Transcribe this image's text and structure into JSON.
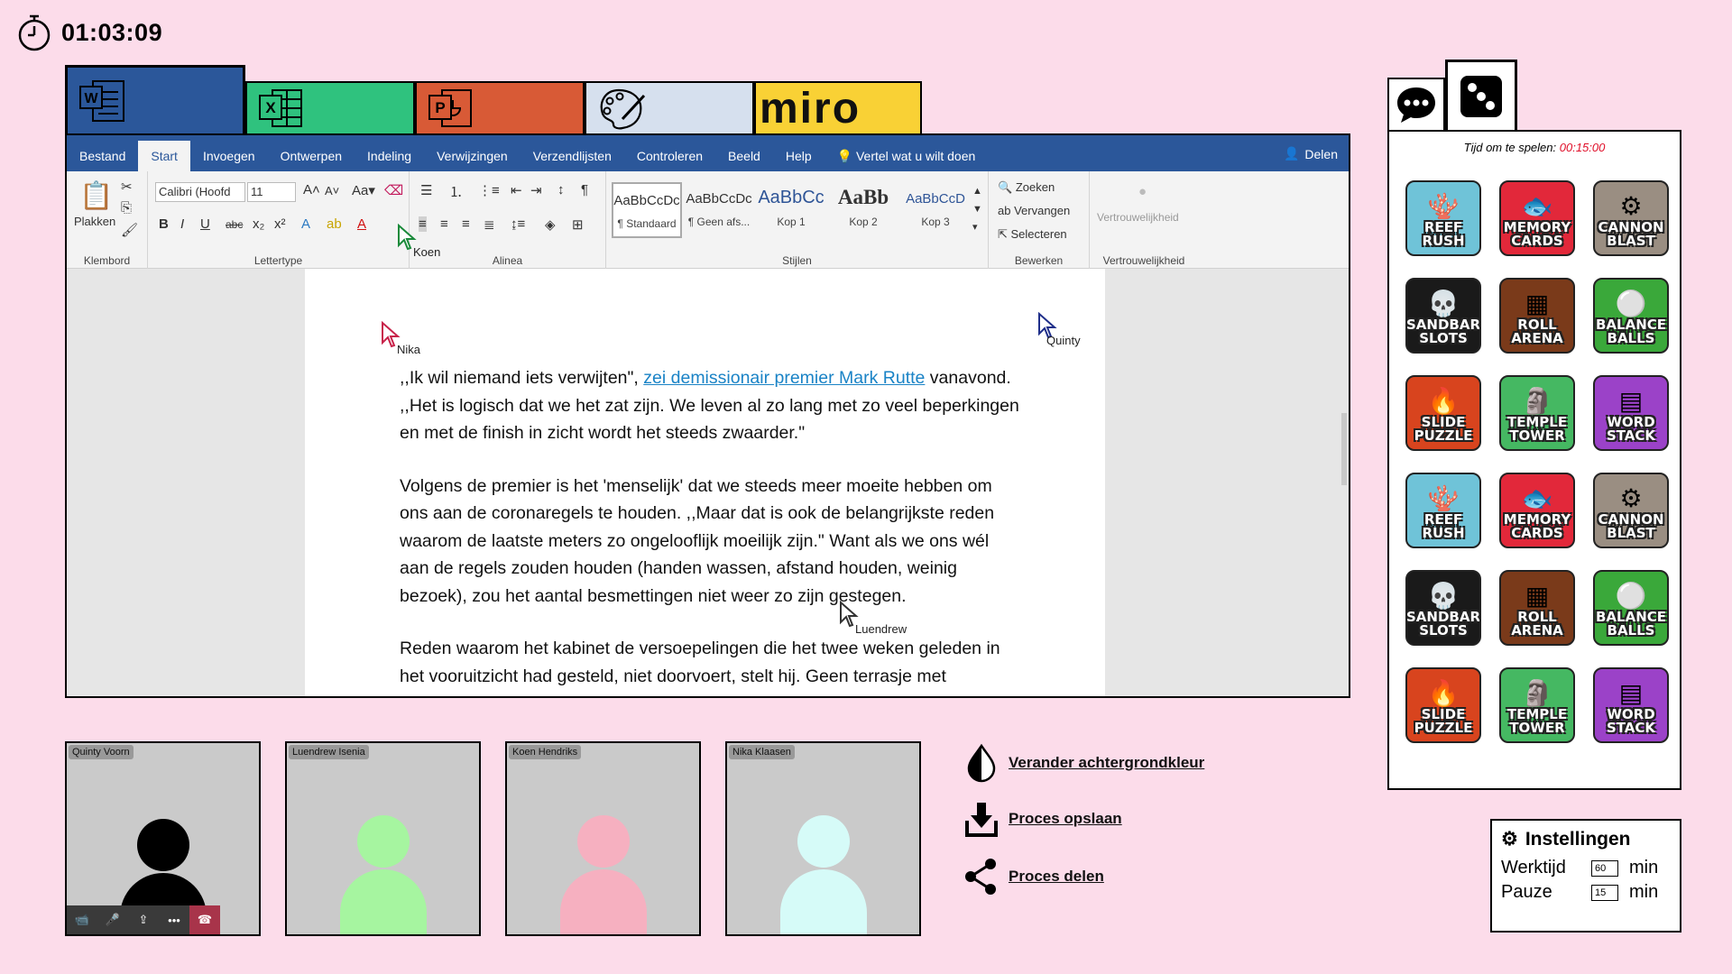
{
  "timer": {
    "value": "01:03:09"
  },
  "apps": {
    "word": "Word",
    "excel": "Excel",
    "powerpoint": "PowerPoint",
    "paint": "Paint",
    "miro": "miro"
  },
  "word": {
    "menu": [
      "Bestand",
      "Start",
      "Invoegen",
      "Ontwerpen",
      "Indeling",
      "Verwijzingen",
      "Verzendlijsten",
      "Controleren",
      "Beeld",
      "Help"
    ],
    "tell_me": "Vertel wat u wilt doen",
    "share": "Delen",
    "ribbon": {
      "paste": "Plakken",
      "clipboard": "Klembord",
      "font_name": "Calibri (Hoofd",
      "font_size": "11",
      "font_group": "Lettertype",
      "paragraph_group": "Alinea",
      "styles_group": "Stijlen",
      "styles": [
        {
          "sample": "AaBbCcDc",
          "name": "¶ Standaard"
        },
        {
          "sample": "AaBbCcDc",
          "name": "¶ Geen afs..."
        },
        {
          "sample": "AaBbCc",
          "name": "Kop 1"
        },
        {
          "sample": "AaBb",
          "name": "Kop 2"
        },
        {
          "sample": "AaBbCcD",
          "name": "Kop 3"
        }
      ],
      "find": "Zoeken",
      "replace": "Vervangen",
      "select": "Selecteren",
      "edit_group": "Bewerken",
      "sensitivity": "Vertrouwelijkheid",
      "sensitivity_group": "Vertrouwelijkheid"
    },
    "doc": {
      "p1_a": ",,Ik wil niemand iets verwijten\", ",
      "p1_link": "zei demissionair premier Mark Rutte",
      "p1_b": " vanavond. ,,Het is logisch dat we het zat zijn. We leven al zo lang met zo veel beperkingen en met de finish in zicht wordt het steeds zwaarder.\"",
      "p2": "Volgens de premier is het 'menselijk' dat we steeds meer moeite hebben om ons aan de coronaregels te houden. ,,Maar dat is ook de belangrijkste reden waarom de laatste meters zo ongelooflijk moeilijk zijn.\" Want als we ons wél aan de regels zouden houden (handen wassen, afstand houden, weinig bezoek), zou het aantal besmettingen niet weer zo zijn gestegen.",
      "p3": "Reden waarom het kabinet de versoepelingen die het twee weken geleden in het vooruitzicht had gesteld, niet doorvoert, stelt hij. Geen terrasje met"
    },
    "cursors": [
      {
        "name": "Nika",
        "color": "#c8234a"
      },
      {
        "name": "Quinty",
        "color": "#1f2f8a"
      },
      {
        "name": "Koen",
        "color": "#1a8a3a"
      },
      {
        "name": "Luendrew",
        "color": "#333333"
      }
    ]
  },
  "participants": [
    {
      "name": "Quinty Voorn",
      "color": "#000000"
    },
    {
      "name": "Luendrew Isenia",
      "color": "#a6f5a0"
    },
    {
      "name": "Koen Hendriks",
      "color": "#f6b0c0"
    },
    {
      "name": "Nika Klaasen",
      "color": "#d6fbf8"
    }
  ],
  "actions": {
    "bg_color": "Verander achtergrondkleur",
    "save": "Proces opslaan",
    "share": "Proces delen"
  },
  "games": {
    "time_label": "Tijd om te spelen:",
    "time_value": "00:15:00",
    "items": [
      {
        "l1": "REEF",
        "l2": "RUSH",
        "bg": "#6fc3d8",
        "deco": "🪸"
      },
      {
        "l1": "MEMORY",
        "l2": "CARDS",
        "bg": "#e2283a",
        "deco": "🐟"
      },
      {
        "l1": "CANNON",
        "l2": "BLAST",
        "bg": "#9a8e82",
        "deco": "⚙"
      },
      {
        "l1": "SANDBAR",
        "l2": "SLOTS",
        "bg": "#1a1a1a",
        "deco": "💀"
      },
      {
        "l1": "ROLL",
        "l2": "ARENA",
        "bg": "#7a3a1a",
        "deco": "▦"
      },
      {
        "l1": "BALANCE",
        "l2": "BALLS",
        "bg": "#3aa83a",
        "deco": "⚪"
      },
      {
        "l1": "SLIDE",
        "l2": "PUZZLE",
        "bg": "#d8441e",
        "deco": "🔥"
      },
      {
        "l1": "TEMPLE",
        "l2": "TOWER",
        "bg": "#45b862",
        "deco": "🗿"
      },
      {
        "l1": "WORD",
        "l2": "STACK",
        "bg": "#9b42c8",
        "deco": "▤"
      },
      {
        "l1": "REEF",
        "l2": "RUSH",
        "bg": "#6fc3d8",
        "deco": "🪸"
      },
      {
        "l1": "MEMORY",
        "l2": "CARDS",
        "bg": "#e2283a",
        "deco": "🐟"
      },
      {
        "l1": "CANNON",
        "l2": "BLAST",
        "bg": "#9a8e82",
        "deco": "⚙"
      },
      {
        "l1": "SANDBAR",
        "l2": "SLOTS",
        "bg": "#1a1a1a",
        "deco": "💀"
      },
      {
        "l1": "ROLL",
        "l2": "ARENA",
        "bg": "#7a3a1a",
        "deco": "▦"
      },
      {
        "l1": "BALANCE",
        "l2": "BALLS",
        "bg": "#3aa83a",
        "deco": "⚪"
      },
      {
        "l1": "SLIDE",
        "l2": "PUZZLE",
        "bg": "#d8441e",
        "deco": "🔥"
      },
      {
        "l1": "TEMPLE",
        "l2": "TOWER",
        "bg": "#45b862",
        "deco": "🗿"
      },
      {
        "l1": "WORD",
        "l2": "STACK",
        "bg": "#9b42c8",
        "deco": "▤"
      }
    ]
  },
  "settings": {
    "title": "Instellingen",
    "work_label": "Werktijd",
    "work_value": "60",
    "pause_label": "Pauze",
    "pause_value": "15",
    "unit": "min"
  }
}
